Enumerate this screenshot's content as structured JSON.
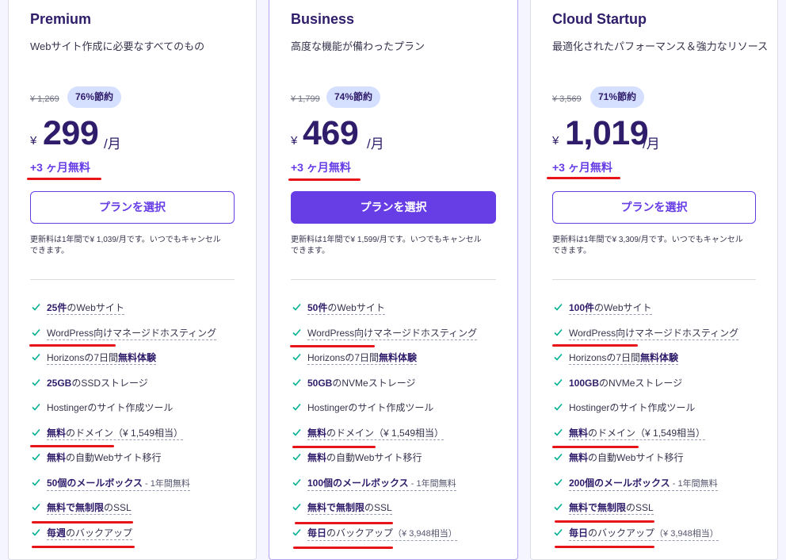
{
  "plans": [
    {
      "name": "Premium",
      "description": "Webサイト作成に必要なすべてのもの",
      "old_price": "¥ 1,269",
      "savings": "76%節約",
      "currency": "¥",
      "price": "299",
      "period": "/月",
      "bonus": "+3 ヶ月無料",
      "cta": "プランを選択",
      "renewal_line1": "更新料は1年間で¥ 1,039/月です。いつでもキャンセル",
      "renewal_line2": "できます。",
      "features": [
        {
          "bold": "25件",
          "text": "のWebサイト"
        },
        {
          "text": "WordPress向けマネージドホスティング"
        },
        {
          "text": "Horizonsの7日間",
          "bold2": "無料体験"
        },
        {
          "bold": "25GB",
          "text": "のSSDストレージ"
        },
        {
          "text": "Hostingerのサイト作成ツール"
        },
        {
          "bold": "無料",
          "text": "のドメイン（¥ 1,549相当）"
        },
        {
          "bold": "無料",
          "text": "の自動Webサイト移行"
        },
        {
          "bold": "50個のメールボックス",
          "sub": " - 1年間無料"
        },
        {
          "bold": "無料で無制限",
          "text": "のSSL"
        },
        {
          "bold": "毎週",
          "text": "のバックアップ"
        }
      ]
    },
    {
      "name": "Business",
      "description": "高度な機能が備わったプラン",
      "old_price": "¥ 1,799",
      "savings": "74%節約",
      "currency": "¥",
      "price": "469",
      "period": "/月",
      "bonus": "+3 ヶ月無料",
      "cta": "プランを選択",
      "renewal_line1": "更新料は1年間で¥ 1,599/月です。いつでもキャンセル",
      "renewal_line2": "できます。",
      "features": [
        {
          "bold": "50件",
          "text": "のWebサイト"
        },
        {
          "text": "WordPress向けマネージドホスティング"
        },
        {
          "text": "Horizonsの7日間",
          "bold2": "無料体験"
        },
        {
          "bold": "50GB",
          "text": "のNVMeストレージ"
        },
        {
          "text": "Hostingerのサイト作成ツール"
        },
        {
          "bold": "無料",
          "text": "のドメイン（¥ 1,549相当）"
        },
        {
          "bold": "無料",
          "text": "の自動Webサイト移行"
        },
        {
          "bold": "100個のメールボックス",
          "sub": " - 1年間無料"
        },
        {
          "bold": "無料で無制限",
          "text": "のSSL"
        },
        {
          "bold": "毎日",
          "text": "のバックアップ",
          "sub": "（¥ 3,948相当）"
        }
      ]
    },
    {
      "name": "Cloud Startup",
      "description": "最適化されたパフォーマンス＆強力なリソース",
      "old_price": "¥ 3,569",
      "savings": "71%節約",
      "currency": "¥",
      "price": "1,019",
      "period": "/月",
      "bonus": "+3 ヶ月無料",
      "cta": "プランを選択",
      "renewal_line1": "更新料は1年間で¥ 3,309/月です。いつでもキャンセル",
      "renewal_line2": "できます。",
      "features": [
        {
          "bold": "100件",
          "text": "のWebサイト"
        },
        {
          "text": "WordPress向けマネージドホスティング"
        },
        {
          "text": "Horizonsの7日間",
          "bold2": "無料体験"
        },
        {
          "bold": "100GB",
          "text": "のNVMeストレージ"
        },
        {
          "text": "Hostingerのサイト作成ツール"
        },
        {
          "bold": "無料",
          "text": "のドメイン（¥ 1,549相当）"
        },
        {
          "bold": "無料",
          "text": "の自動Webサイト移行"
        },
        {
          "bold": "200個のメールボックス",
          "sub": " - 1年間無料"
        },
        {
          "bold": "無料で無制限",
          "text": "のSSL"
        },
        {
          "bold": "毎日",
          "text": "のバックアップ",
          "sub": "（¥ 3,948相当）"
        }
      ]
    }
  ],
  "colors": {
    "accent": "#673de6",
    "heading": "#2f1c6a",
    "badge_bg": "#d5dfff",
    "check": "#00b090",
    "annotation_red": "#e8141a"
  },
  "icons": {
    "feature_check": "check-icon"
  }
}
